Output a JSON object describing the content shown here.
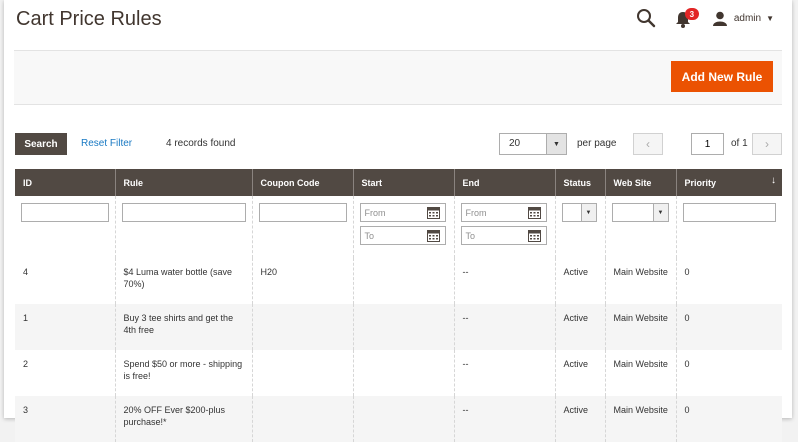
{
  "header": {
    "title": "Cart Price Rules",
    "notification_count": "3",
    "user_name": "admin"
  },
  "actions": {
    "add_new_rule": "Add New Rule"
  },
  "toolbar": {
    "search_label": "Search",
    "reset_filter": "Reset Filter",
    "records_found": "4 records found",
    "per_page_value": "20",
    "per_page_label": "per page",
    "page_value": "1",
    "page_of": "of 1"
  },
  "columns": [
    "ID",
    "Rule",
    "Coupon Code",
    "Start",
    "End",
    "Status",
    "Web Site",
    "Priority"
  ],
  "filters": {
    "from_placeholder": "From",
    "to_placeholder": "To"
  },
  "rows": [
    {
      "id": "4",
      "rule": "$4 Luma water bottle (save 70%)",
      "coupon": "H20",
      "start": "",
      "end": "--",
      "status": "Active",
      "website": "Main Website",
      "priority": "0"
    },
    {
      "id": "1",
      "rule": "Buy 3 tee shirts and get the 4th free",
      "coupon": "",
      "start": "",
      "end": "--",
      "status": "Active",
      "website": "Main Website",
      "priority": "0"
    },
    {
      "id": "2",
      "rule": "Spend $50 or more - shipping is free!",
      "coupon": "",
      "start": "",
      "end": "--",
      "status": "Active",
      "website": "Main Website",
      "priority": "0"
    },
    {
      "id": "3",
      "rule": "20% OFF Ever $200-plus purchase!*",
      "coupon": "",
      "start": "",
      "end": "--",
      "status": "Active",
      "website": "Main Website",
      "priority": "0"
    }
  ],
  "colors": {
    "accent": "#eb5202",
    "header_bg": "#514943",
    "link": "#1979c3",
    "badge": "#e22626"
  },
  "icons": [
    "search-icon",
    "bell-icon",
    "user-icon",
    "calendar-icon",
    "chevron-left-icon",
    "chevron-right-icon",
    "sort-arrow-icon"
  ]
}
